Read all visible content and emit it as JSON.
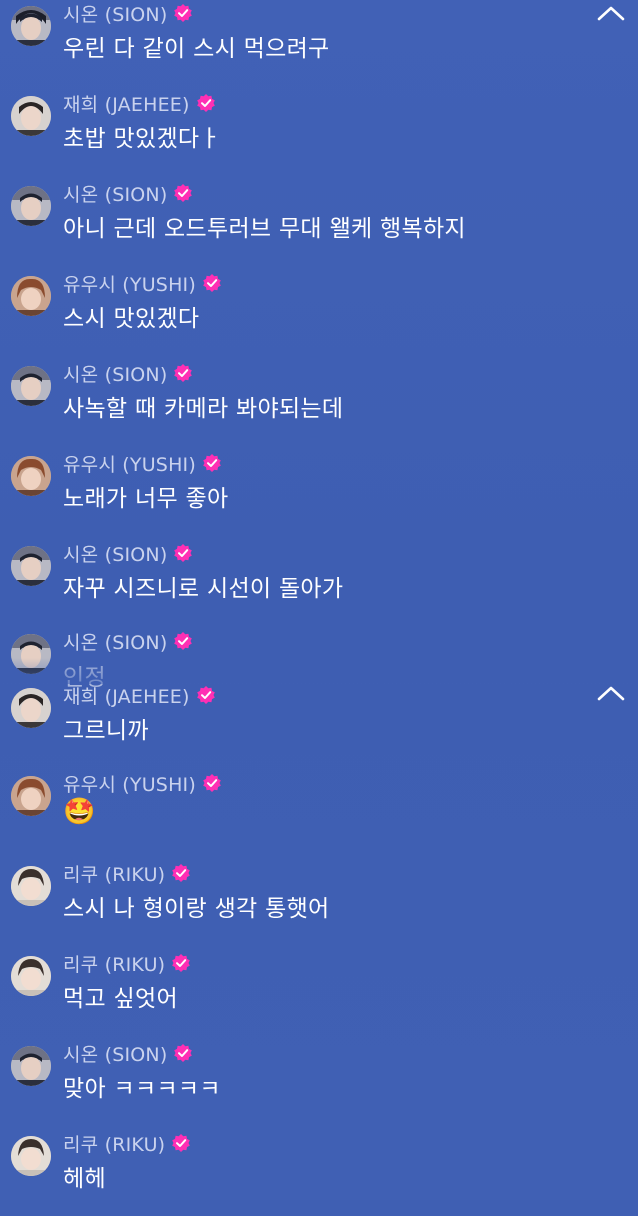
{
  "messages": [
    {
      "name": "시온 (SION)",
      "text": "우린 다 같이 스시 먹으려구",
      "avatar": "sion"
    },
    {
      "name": "재희 (JAEHEE)",
      "text": "초밥 맛있겠다ㅏ",
      "avatar": "jaehee"
    },
    {
      "name": "시온 (SION)",
      "text": "아니 근데 오드투러브 무대 왤케 행복하지",
      "avatar": "sion"
    },
    {
      "name": "유우시 (YUSHI)",
      "text": "스시 맛있겠다",
      "avatar": "yushi"
    },
    {
      "name": "시온 (SION)",
      "text": "사녹할 때 카메라 봐야되는데",
      "avatar": "sion"
    },
    {
      "name": "유우시 (YUSHI)",
      "text": "노래가 너무 좋아",
      "avatar": "yushi"
    },
    {
      "name": "시온 (SION)",
      "text": "자꾸 시즈니로 시선이 돌아가",
      "avatar": "sion"
    },
    {
      "name": "시온 (SION)",
      "text": "인정",
      "avatar": "sion"
    },
    {
      "name": "재희 (JAEHEE)",
      "text": "그르니까",
      "avatar": "jaehee"
    },
    {
      "name": "유우시 (YUSHI)",
      "text": "🤩",
      "avatar": "yushi"
    },
    {
      "name": "리쿠 (RIKU)",
      "text": "스시 나 형이랑 생각 통햇어",
      "avatar": "riku"
    },
    {
      "name": "리쿠 (RIKU)",
      "text": "먹고 싶엇어",
      "avatar": "riku"
    },
    {
      "name": "시온 (SION)",
      "text": "맞아 ㅋㅋㅋㅋㅋ",
      "avatar": "sion"
    },
    {
      "name": "리쿠 (RIKU)",
      "text": "헤헤",
      "avatar": "riku"
    }
  ],
  "icons": {
    "collapse": "chevron-up-icon",
    "verified": "verified-badge-icon"
  },
  "colors": {
    "background": "#3f5fb3",
    "verified_badge": "#ff2fb4",
    "name_text": "#e8ecfa",
    "message_text": "#ffffff"
  }
}
